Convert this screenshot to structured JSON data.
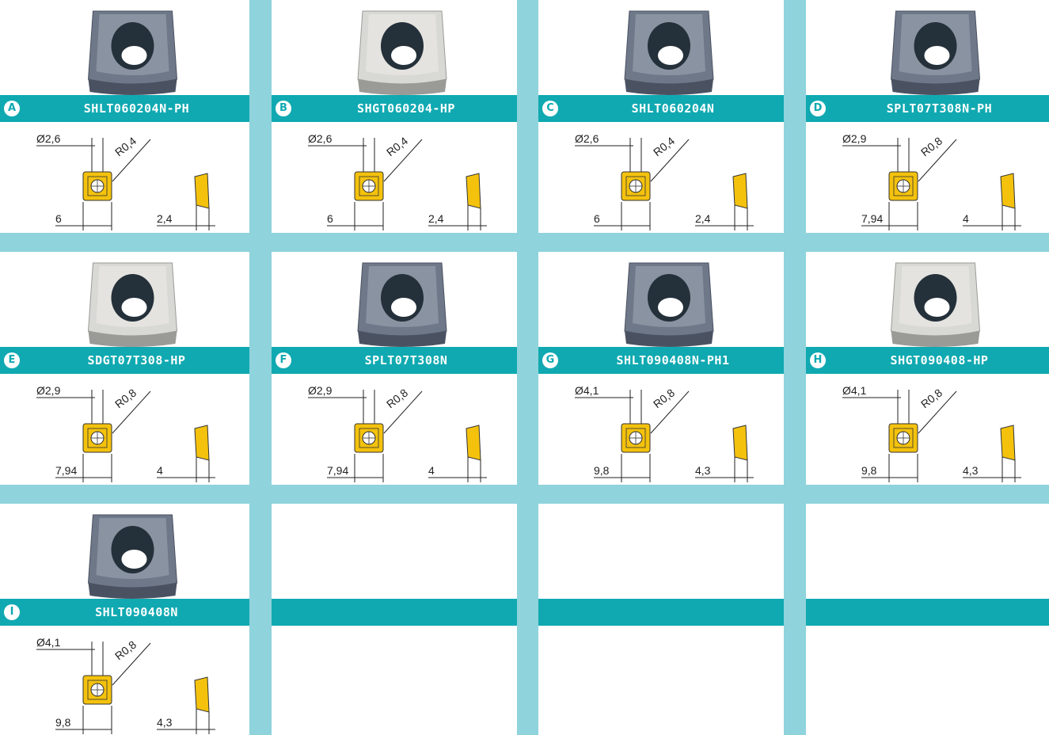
{
  "inserts": [
    {
      "letter": "A",
      "code": "SHLT060204N-PH",
      "diameter": "Ø2,6",
      "radius": "R0,4",
      "width": "6",
      "thickness": "2,4",
      "material": "dark"
    },
    {
      "letter": "B",
      "code": "SHGT060204-HP",
      "diameter": "Ø2,6",
      "radius": "R0,4",
      "width": "6",
      "thickness": "2,4",
      "material": "light"
    },
    {
      "letter": "C",
      "code": "SHLT060204N",
      "diameter": "Ø2,6",
      "radius": "R0,4",
      "width": "6",
      "thickness": "2,4",
      "material": "dark"
    },
    {
      "letter": "D",
      "code": "SPLT07T308N-PH",
      "diameter": "Ø2,9",
      "radius": "R0,8",
      "width": "7,94",
      "thickness": "4",
      "material": "dark"
    },
    {
      "letter": "E",
      "code": "SDGT07T308-HP",
      "diameter": "Ø2,9",
      "radius": "R0,8",
      "width": "7,94",
      "thickness": "4",
      "material": "light"
    },
    {
      "letter": "F",
      "code": "SPLT07T308N",
      "diameter": "Ø2,9",
      "radius": "R0,8",
      "width": "7,94",
      "thickness": "4",
      "material": "dark"
    },
    {
      "letter": "G",
      "code": "SHLT090408N-PH1",
      "diameter": "Ø4,1",
      "radius": "R0,8",
      "width": "9,8",
      "thickness": "4,3",
      "material": "dark"
    },
    {
      "letter": "H",
      "code": "SHGT090408-HP",
      "diameter": "Ø4,1",
      "radius": "R0,8",
      "width": "9,8",
      "thickness": "4,3",
      "material": "light"
    },
    {
      "letter": "I",
      "code": "SHLT090408N",
      "diameter": "Ø4,1",
      "radius": "R0,8",
      "width": "9,8",
      "thickness": "4,3",
      "material": "dark"
    }
  ],
  "colors": {
    "band": "#10a9b1",
    "background": "#8fd3dc",
    "insert_yellow": "#f4c20d",
    "dark_carbide": "#6b7585",
    "light_carbide": "#d9d9d6"
  }
}
